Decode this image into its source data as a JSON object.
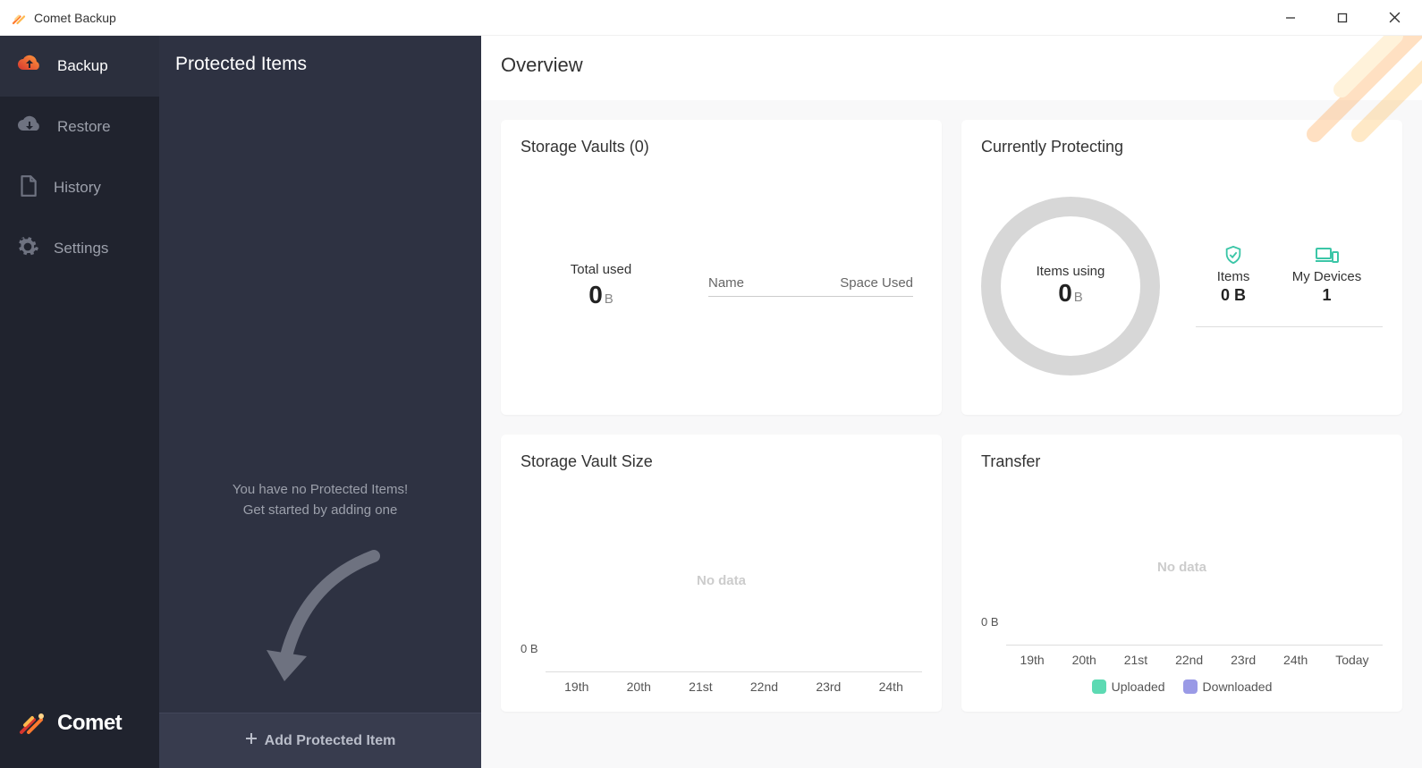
{
  "titlebar": {
    "title": "Comet Backup"
  },
  "sidebar": {
    "items": [
      {
        "label": "Backup",
        "icon": "cloud-up",
        "active": true
      },
      {
        "label": "Restore",
        "icon": "cloud-down",
        "active": false
      },
      {
        "label": "History",
        "icon": "file",
        "active": false
      },
      {
        "label": "Settings",
        "icon": "gear",
        "active": false
      }
    ],
    "footer_brand": "Comet"
  },
  "panel": {
    "title": "Protected Items",
    "empty_line1": "You have no Protected Items!",
    "empty_line2": "Get started by adding one",
    "action_label": "Add Protected Item"
  },
  "main": {
    "title": "Overview",
    "storage_vaults": {
      "title": "Storage Vaults (0)",
      "total_label": "Total used",
      "total_value": "0",
      "total_unit": "B",
      "col_name": "Name",
      "col_space": "Space Used"
    },
    "protecting": {
      "title": "Currently Protecting",
      "ring_label": "Items using",
      "ring_value": "0",
      "ring_unit": "B",
      "stat_items_label": "Items",
      "stat_items_value": "0 B",
      "stat_devices_label": "My Devices",
      "stat_devices_value": "1"
    },
    "vault_size": {
      "title": "Storage Vault Size",
      "no_data": "No data",
      "y0": "0 B",
      "x": [
        "19th",
        "20th",
        "21st",
        "22nd",
        "23rd",
        "24th"
      ]
    },
    "transfer": {
      "title": "Transfer",
      "no_data": "No data",
      "y0": "0 B",
      "x": [
        "19th",
        "20th",
        "21st",
        "22nd",
        "23rd",
        "24th",
        "Today"
      ],
      "legend_up": "Uploaded",
      "legend_down": "Downloaded",
      "color_up": "#5ddab3",
      "color_down": "#9a9ae6"
    }
  },
  "chart_data": [
    {
      "type": "bar",
      "title": "Storage Vault Size",
      "categories": [
        "19th",
        "20th",
        "21st",
        "22nd",
        "23rd",
        "24th"
      ],
      "values": [],
      "xlabel": "",
      "ylabel": "",
      "ylim": [
        0,
        0
      ],
      "note": "No data"
    },
    {
      "type": "bar",
      "title": "Transfer",
      "categories": [
        "19th",
        "20th",
        "21st",
        "22nd",
        "23rd",
        "24th",
        "Today"
      ],
      "series": [
        {
          "name": "Uploaded",
          "values": []
        },
        {
          "name": "Downloaded",
          "values": []
        }
      ],
      "xlabel": "",
      "ylabel": "",
      "ylim": [
        0,
        0
      ],
      "note": "No data"
    }
  ]
}
